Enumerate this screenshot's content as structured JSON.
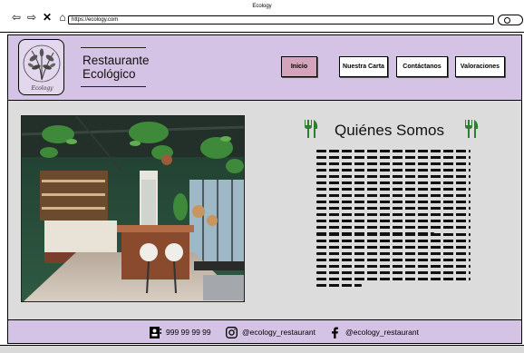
{
  "browser": {
    "window_title": "Ecology",
    "url": "https://ecology.com"
  },
  "header": {
    "logo_text": "Ecology",
    "brand_line1": "Restaurante",
    "brand_line2": "Ecológico",
    "nav": [
      {
        "label": "Inicio",
        "active": true
      },
      {
        "label": "Nuestra Carta",
        "active": false
      },
      {
        "label": "Contáctanos",
        "active": false
      },
      {
        "label": "Valoraciones",
        "active": false
      }
    ]
  },
  "main": {
    "title": "Quiénes Somos",
    "image_subject": "restaurant interior with plants"
  },
  "footer": {
    "phone": "999 99 99 99",
    "instagram": "@ecology_restaurant",
    "facebook": "@ecology_restaurant"
  },
  "colors": {
    "header_bg": "#d5c3e6",
    "main_bg": "#dcdcdc",
    "active_nav": "#d3a4bb",
    "fork_icon": "#2e7d32"
  },
  "icons": [
    "back-arrow-icon",
    "forward-arrow-icon",
    "close-icon",
    "home-icon",
    "search-icon",
    "fork-knife-icon",
    "contact-card-icon",
    "instagram-icon",
    "facebook-icon"
  ]
}
